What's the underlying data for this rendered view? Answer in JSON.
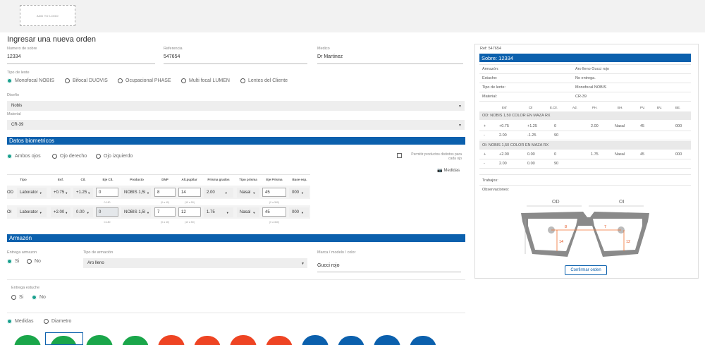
{
  "header": {
    "logo_text": "ADD TO LOGO"
  },
  "page": {
    "title": "Ingresar una nueva orden"
  },
  "form": {
    "sobre_label": "Numero de sobre",
    "sobre_value": "12334",
    "ref_label": "Referencia",
    "ref_value": "547654",
    "medico_label": "Medico",
    "medico_value": "Dr Martinez",
    "tipo_label": "Tipo de lente",
    "tipo_options": [
      "Monofocal NOBIS",
      "Bifocal DUOVIS",
      "Ocupacional PHASE",
      "Multi focal LUMEN",
      "Lentes del Cliente"
    ],
    "diseno_label": "Diseño",
    "diseno_value": "Nobis",
    "material_label": "Material",
    "material_value": "CR-39"
  },
  "bio": {
    "section_title": "Datos biometricos",
    "eye_options": [
      "Ambos ojos",
      "Ojo derecho",
      "Ojo izquierdo"
    ],
    "permitir_label": "Permitir productos distintos para cada ojo",
    "medidas_label": "Medidas",
    "headers": [
      "Tipo",
      "Esf.",
      "Cil.",
      "Eje Cil.",
      "Producto",
      "DNP",
      "Alt.pupilar",
      "Prisma grados",
      "Tipo prisma",
      "Eje Prisma",
      "Base esp."
    ],
    "rows": [
      {
        "eye": "OD",
        "tipo": "Laborator",
        "esf": "+0.75",
        "cil": "+1.25",
        "eje": "0",
        "producto": "NOBIS 1,5l",
        "dnp": "8",
        "alt": "14",
        "prisma": "2.00",
        "tipo_prisma": "Nasal",
        "eje_prisma": "45",
        "base": "000",
        "hints": {
          "eje": "0-180",
          "dnp": "(0 a 40)",
          "alt": "(10 a 50)",
          "eje_prisma": "(0 a 360)"
        }
      },
      {
        "eye": "OI",
        "tipo": "Laborator",
        "esf": "+2.00",
        "cil": "0.00",
        "eje": "0",
        "producto": "NOBIS 1,5l",
        "dnp": "7",
        "alt": "12",
        "prisma": "1.75",
        "tipo_prisma": "Nasal",
        "eje_prisma": "45",
        "base": "000",
        "hints": {
          "eje": "0-180",
          "dnp": "(0 a 40)",
          "alt": "(10 a 50)",
          "eje_prisma": "(0 a 360)"
        }
      }
    ]
  },
  "armazon": {
    "section_title": "Armazón",
    "entrega_label": "Entrega armazon",
    "entrega_options": [
      "Si",
      "No"
    ],
    "tipo_label": "Tipo de armación",
    "tipo_value": "Aro lleno",
    "marca_label": "Marca / modelo / color",
    "marca_value": "Gucci rojo",
    "estuche_label": "Entrega estuche",
    "estuche_options": [
      "Si",
      "No"
    ],
    "medida_options": [
      "Medidas",
      "Diametro"
    ]
  },
  "summary": {
    "ref": "Ref: 547654",
    "sobre_title": "Sobre: 12334",
    "details": [
      {
        "k": "Armazón:",
        "v": "Aro lleno Gucci rojo"
      },
      {
        "k": "Estuche:",
        "v": "No entrega."
      },
      {
        "k": "Tipo de lente:",
        "v": "Monofocal NOBIS"
      },
      {
        "k": "Material:",
        "v": "CR-39"
      }
    ],
    "table_headers": [
      "Esf",
      "Cil",
      "E.Cil.",
      "Ad.",
      "PH.",
      "BH.",
      "PV.",
      "BV.",
      "BE."
    ],
    "od_title": "OD: NOBIS 1,50 COLOR EN MAZA RX",
    "od_rows": [
      [
        "+",
        "+0.75",
        "+1.25",
        "0",
        "",
        "2.00",
        "Nasal",
        "45",
        "",
        "000"
      ],
      [
        "-",
        "2.00",
        "-1.25",
        "90",
        "",
        "",
        "",
        "",
        "",
        ""
      ]
    ],
    "oi_title": "OI: NOBIS 1,50 COLOR EN MAZA RX",
    "oi_rows": [
      [
        "+",
        "+2.00",
        "0.00",
        "0",
        "",
        "1.75",
        "Nasal",
        "45",
        "",
        "000"
      ],
      [
        "-",
        "2.00",
        "0.00",
        "90",
        "",
        "",
        "",
        "",
        "",
        ""
      ]
    ],
    "trabajos_label": "Trabajos:",
    "observaciones_label": "Observaciones:",
    "diagram": {
      "od": "OD",
      "oi": "OI",
      "od_dnp": "8",
      "od_alt": "14",
      "oi_dnp": "7",
      "oi_alt": "12"
    },
    "confirm_label": "Confirmar orden"
  },
  "colors": {
    "accent": "#0b60ad",
    "radio": "#1aa08e"
  },
  "lens_shapes": [
    {
      "color": "#1aa64a"
    },
    {
      "color": "#1aa64a"
    },
    {
      "color": "#1aa64a"
    },
    {
      "color": "#1aa64a"
    },
    {
      "color": "#ee4423"
    },
    {
      "color": "#ee4423"
    },
    {
      "color": "#ee4423"
    },
    {
      "color": "#ee4423"
    },
    {
      "color": "#0b60ad"
    },
    {
      "color": "#0b60ad"
    },
    {
      "color": "#0b60ad"
    },
    {
      "color": "#0b60ad"
    }
  ]
}
